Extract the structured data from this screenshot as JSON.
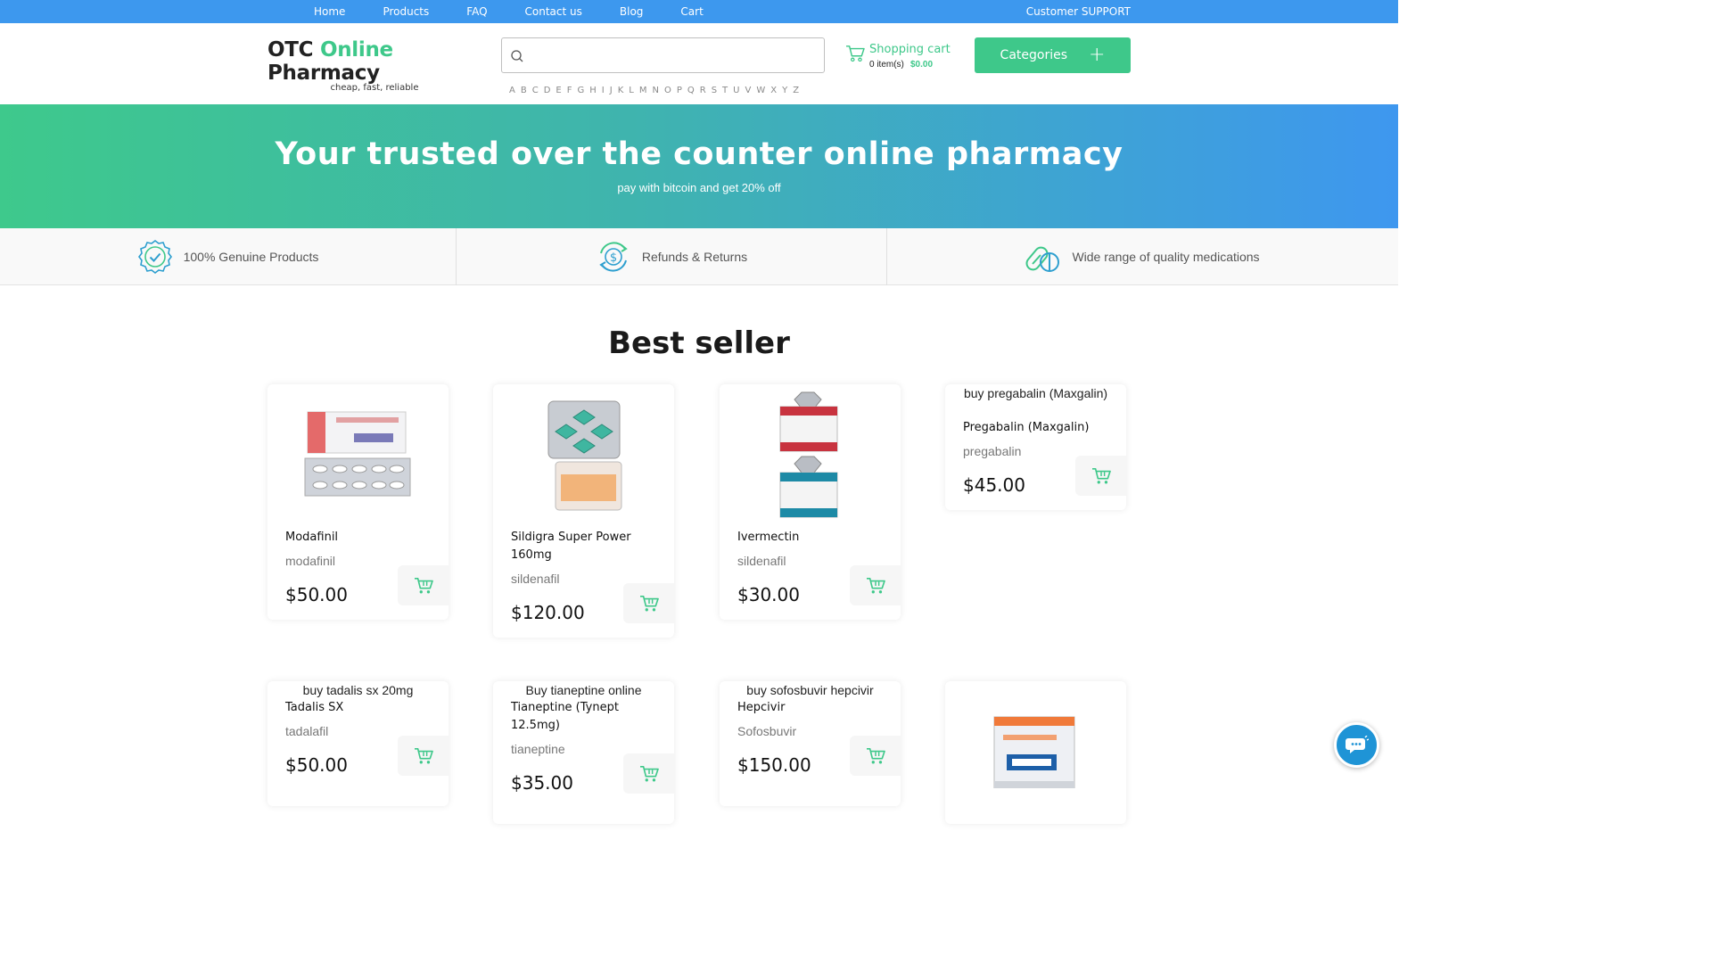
{
  "topnav": {
    "items": [
      {
        "label": "Home"
      },
      {
        "label": "Products"
      },
      {
        "label": "FAQ"
      },
      {
        "label": "Contact us"
      },
      {
        "label": "Blog"
      },
      {
        "label": "Cart"
      }
    ],
    "support": "Customer SUPPORT"
  },
  "brand": {
    "part1": "OTC",
    "part2": "Online",
    "part3": "Pharmacy",
    "tagline": "cheap, fast, reliable"
  },
  "search": {
    "value": "",
    "placeholder": ""
  },
  "alphabet": [
    "A",
    "B",
    "C",
    "D",
    "E",
    "F",
    "G",
    "H",
    "I",
    "J",
    "K",
    "L",
    "M",
    "N",
    "O",
    "P",
    "Q",
    "R",
    "S",
    "T",
    "U",
    "V",
    "W",
    "X",
    "Y",
    "Z"
  ],
  "cart": {
    "label": "Shopping cart",
    "items": "0 item(s)",
    "total": "$0.00"
  },
  "categories_button": "Categories",
  "hero": {
    "title": "Your trusted over the counter online pharmacy",
    "subtitle": "pay with bitcoin and get 20% off"
  },
  "features": [
    {
      "text": "100% Genuine Products",
      "icon": "badge-check-icon"
    },
    {
      "text": "Refunds & Returns",
      "icon": "refund-dollar-icon"
    },
    {
      "text": "Wide range of quality medications",
      "icon": "pills-icon"
    }
  ],
  "section_title": "Best seller",
  "products": [
    {
      "name": "Modafinil",
      "generic": "modafinil",
      "price": "$50.00",
      "image_alt": ""
    },
    {
      "name": "Sildigra Super Power 160mg",
      "generic": "sildenafil",
      "price": "$120.00",
      "image_alt": ""
    },
    {
      "name": "Ivermectin",
      "generic": "sildenafil",
      "price": "$30.00",
      "image_alt": ""
    },
    {
      "name": "Pregabalin (Maxgalin)",
      "generic": "pregabalin",
      "price": "$45.00",
      "image_alt": "buy pregabalin (Maxgalin)"
    },
    {
      "name": "Tadalis SX",
      "generic": "tadalafil",
      "price": "$50.00",
      "image_alt": "buy tadalis sx 20mg"
    },
    {
      "name": "Tianeptine (Tynept 12.5mg)",
      "generic": "tianeptine",
      "price": "$35.00",
      "image_alt": "Buy tianeptine online"
    },
    {
      "name": "Hepcivir",
      "generic": "Sofosbuvir",
      "price": "$150.00",
      "image_alt": "buy sofosbuvir hepcivir"
    },
    {
      "name": "",
      "generic": "",
      "price": "",
      "image_alt": ""
    }
  ],
  "colors": {
    "accent": "#3ec88a",
    "topbar": "#3d98ee",
    "chat": "#1f94d6"
  }
}
